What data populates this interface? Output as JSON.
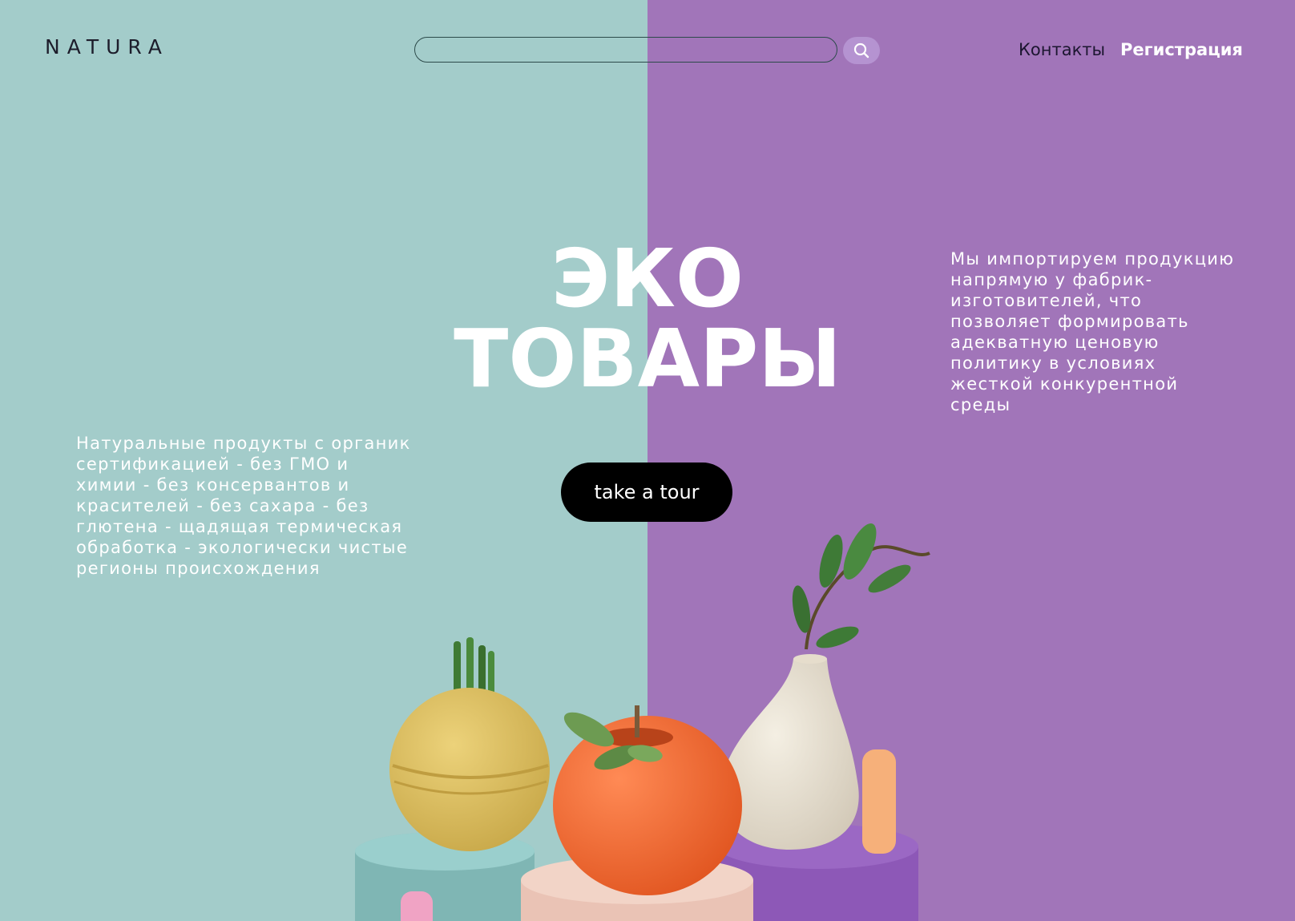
{
  "header": {
    "logo": "NATURA",
    "search": {
      "value": "",
      "placeholder": ""
    },
    "nav": {
      "contacts": "Контакты",
      "register": "Регистрация"
    }
  },
  "hero": {
    "title_line1": "ЭКО",
    "title_line2": "ТОВАРЫ",
    "cta_label": "take a tour"
  },
  "left_description": "Натуральные продукты с органик сертификацией - без ГМО и химии - без консервантов и красителей - без сахара - без глютена - щадящая термическая обработка - экологически чистые регионы происхождения",
  "right_description": "Мы импортируем продукцию напрямую у фабрик-изготовителей, что позволяет формировать адекватную ценовую политику в условиях жесткой конкурентной среды",
  "colors": {
    "left_background": "#a3ccca",
    "right_background": "#a175b9",
    "cta_background": "#000000",
    "text": "#ffffff"
  },
  "icons": {
    "search": "search-icon"
  }
}
